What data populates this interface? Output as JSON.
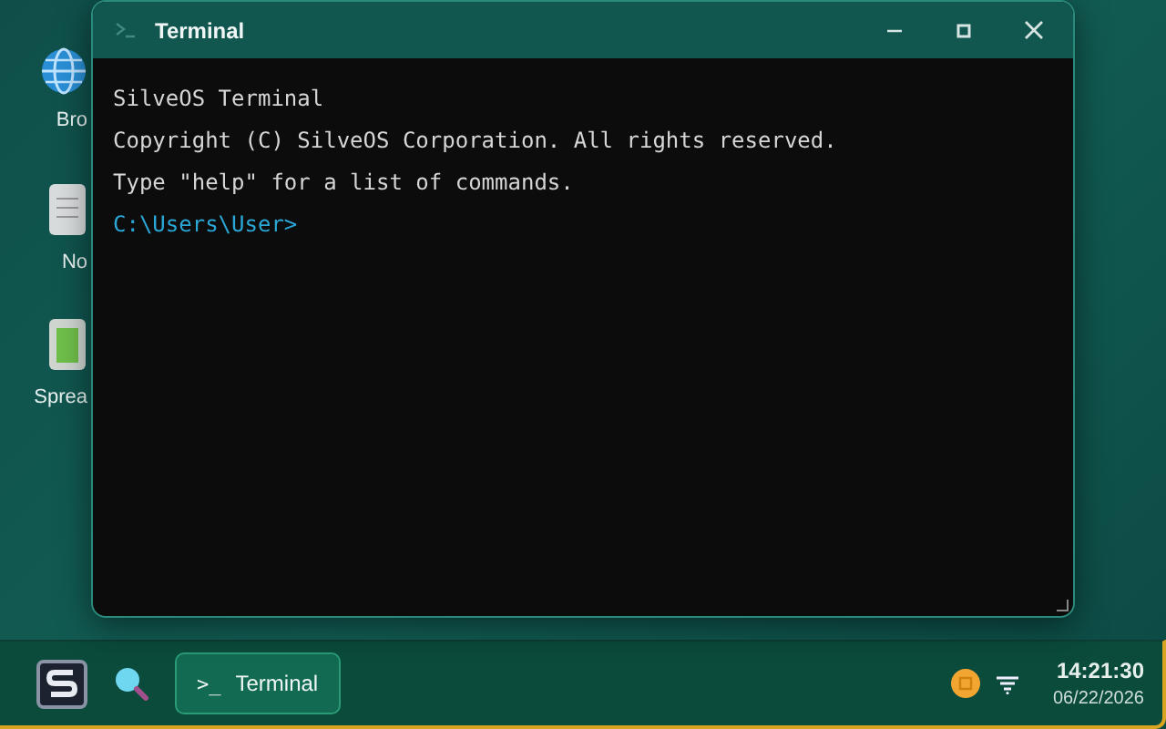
{
  "desktop_icons": [
    {
      "label": "Bro",
      "kind": "globe"
    },
    {
      "label": "No",
      "kind": "notepad"
    },
    {
      "label": "Sprea",
      "kind": "spreadsheet"
    }
  ],
  "window": {
    "title": "Terminal",
    "lines": [
      {
        "text": "SilveOS Terminal",
        "kind": "output"
      },
      {
        "text": "Copyright (C) SilveOS Corporation. All rights reserved.",
        "kind": "output"
      },
      {
        "text": "Type \"help\" for a list of commands.",
        "kind": "output"
      },
      {
        "text": "C:\\Users\\User>",
        "kind": "prompt"
      }
    ]
  },
  "taskbar": {
    "apps": [
      {
        "icon": ">_",
        "label": "Terminal",
        "selected": true
      }
    ],
    "clock": {
      "time": "14:21:30",
      "date": "06/22/2026"
    }
  }
}
